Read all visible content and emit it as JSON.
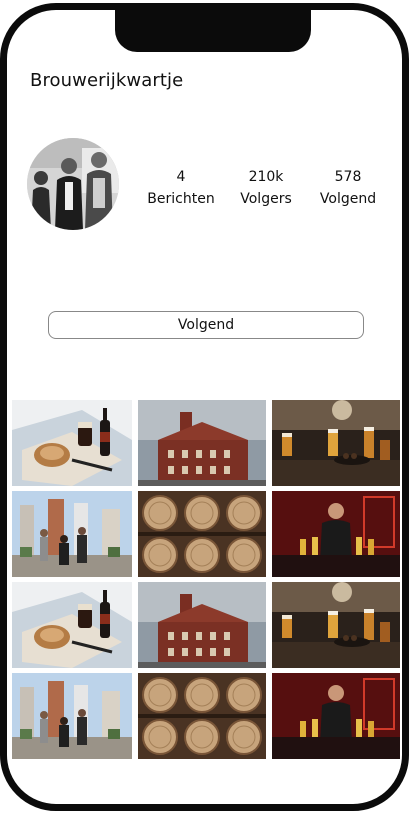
{
  "profile": {
    "username": "Brouwerijkwartje",
    "stats": [
      {
        "value": "4",
        "label": "Berichten"
      },
      {
        "value": "210k",
        "label": "Volgers"
      },
      {
        "value": "578",
        "label": "Volgend"
      }
    ],
    "follow_button_label": "Volgend"
  },
  "posts": [
    {
      "icon": "photo-bread-beer"
    },
    {
      "icon": "photo-brewery-building"
    },
    {
      "icon": "photo-beer-glasses"
    },
    {
      "icon": "photo-team-city"
    },
    {
      "icon": "photo-barrels"
    },
    {
      "icon": "photo-bar-woman"
    },
    {
      "icon": "photo-bread-beer"
    },
    {
      "icon": "photo-brewery-building"
    },
    {
      "icon": "photo-beer-glasses"
    },
    {
      "icon": "photo-team-city"
    },
    {
      "icon": "photo-barrels"
    },
    {
      "icon": "photo-bar-woman"
    }
  ]
}
